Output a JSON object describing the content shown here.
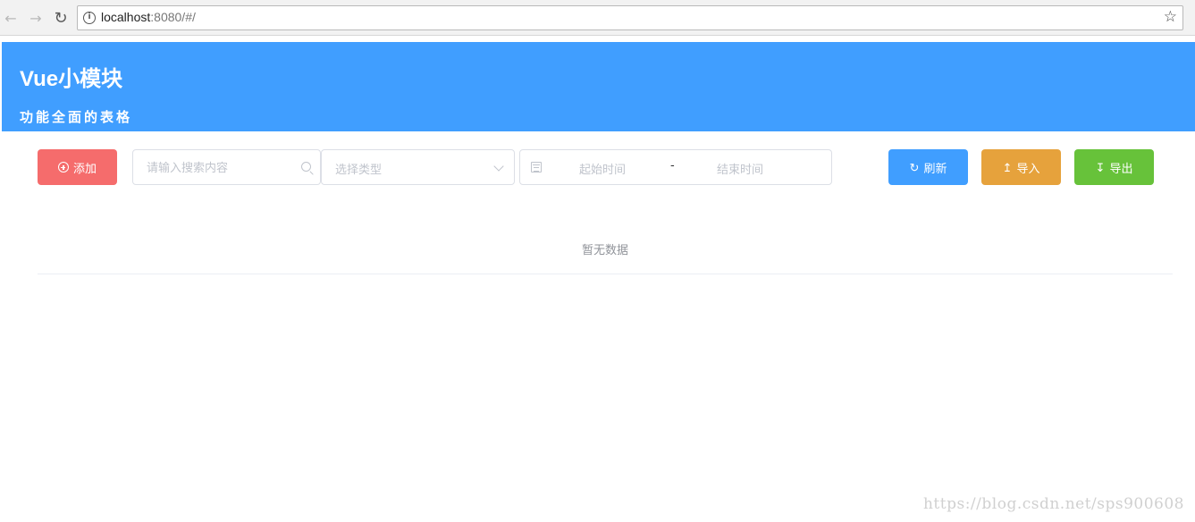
{
  "browser": {
    "url_host": "localhost",
    "url_rest": ":8080/#/",
    "icons": {
      "back": "arrow-left-icon",
      "forward": "arrow-right-icon",
      "reload": "reload-icon",
      "info": "info-icon",
      "bookmark": "star-icon"
    }
  },
  "header": {
    "title": "Vue小模块",
    "subtitle": "功能全面的表格",
    "background": "#409eff"
  },
  "toolbar": {
    "add_label": "添加",
    "search_placeholder": "请输入搜索内容",
    "type_placeholder": "选择类型",
    "date_start_placeholder": "起始时间",
    "date_separator": "-",
    "date_end_placeholder": "结束时间",
    "refresh_label": "刷新",
    "import_label": "导入",
    "export_label": "导出",
    "colors": {
      "add": "#f56c6c",
      "refresh": "#409eff",
      "import": "#e6a23c",
      "export": "#67c23a"
    }
  },
  "table": {
    "empty_text": "暂无数据"
  },
  "watermark": "https://blog.csdn.net/sps900608"
}
